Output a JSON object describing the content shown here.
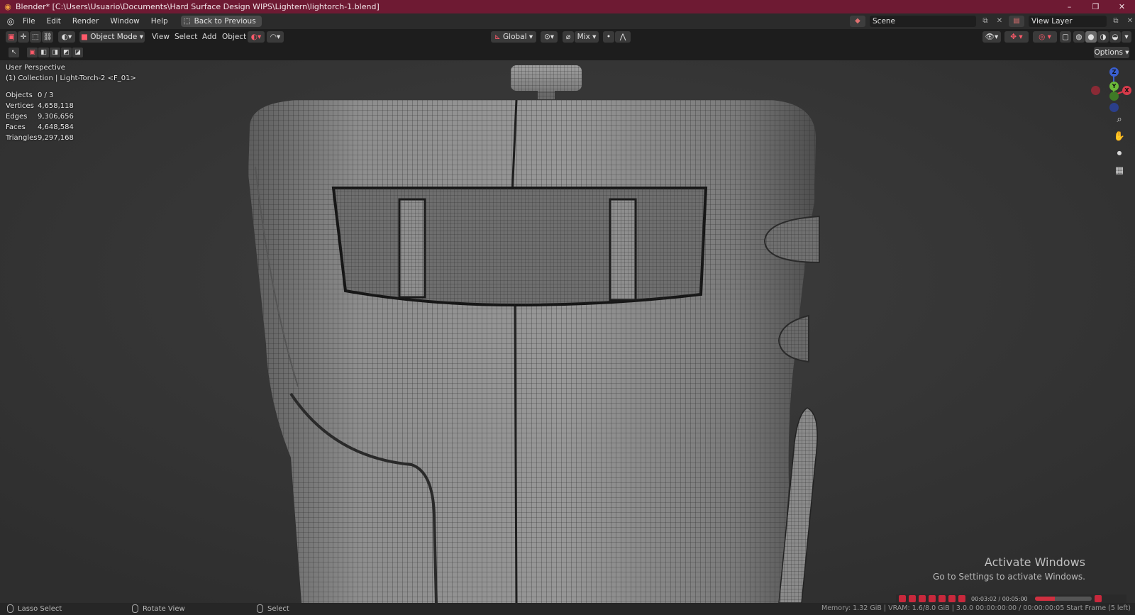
{
  "window": {
    "title": "Blender* [C:\\Users\\Usuario\\Documents\\Hard Surface Design WIPS\\Lightern\\lightorch-1.blend]",
    "minimize": "–",
    "restore": "❐",
    "close": "✕"
  },
  "menubar": {
    "items": [
      "File",
      "Edit",
      "Render",
      "Window",
      "Help"
    ],
    "back_button": "Back to Previous",
    "scene_label": "Scene",
    "view_layer_label": "View Layer"
  },
  "header": {
    "mode": "Object Mode",
    "menus": [
      "View",
      "Select",
      "Add",
      "Object"
    ],
    "transform_orientation": "Global",
    "snap_mode": "Mix"
  },
  "toolrow": {
    "options_label": "Options"
  },
  "viewport": {
    "view_name": "User Perspective",
    "collection_info": "(1) Collection | Light-Torch-2 <F_01>",
    "stats": [
      {
        "label": "Objects",
        "value": "0 / 3"
      },
      {
        "label": "Vertices",
        "value": "4,658,118"
      },
      {
        "label": "Edges",
        "value": "9,306,656"
      },
      {
        "label": "Faces",
        "value": "4,648,584"
      },
      {
        "label": "Triangles",
        "value": "9,297,168"
      }
    ],
    "gizmo": {
      "z": "Z",
      "y": "Y",
      "x": "X"
    },
    "activate_title": "Activate Windows",
    "activate_sub": "Go to Settings to activate Windows.",
    "playback_time": "00:03:02 / 00:05:00",
    "playback_progress": 0.35
  },
  "statusbar": {
    "lasso": "Lasso Select",
    "rotate": "Rotate View",
    "select": "Select",
    "info": "Memory: 1.32 GiB | VRAM: 1.6/8.0 GiB | 3.0.0   00:00:00:00 / 00:00:00:05   Start Frame (5 left)"
  },
  "colors": {
    "titlebar": "#6e1a33",
    "accent_red": "#c8283c",
    "viewport_bg": "#3a3a3a",
    "mesh_fill": "#8a8a8a"
  }
}
